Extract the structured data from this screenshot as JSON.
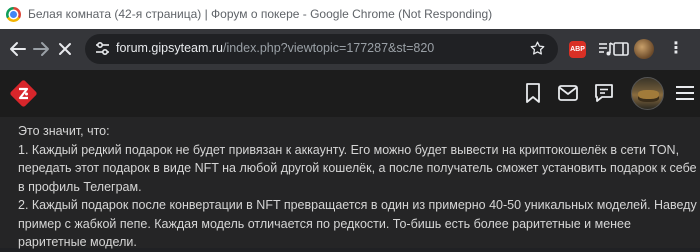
{
  "window": {
    "title": "Белая комната (42-я страница) | Форум о покере - Google Chrome (Not Responding)"
  },
  "toolbar": {
    "back_icon": "back-arrow-icon",
    "forward_icon": "forward-arrow-icon",
    "stop_icon": "stop-loading-icon",
    "url_host": "forum.gipsyteam.ru",
    "url_path": "/index.php?viewtopic=177287&st=820",
    "abp_label": "ABP",
    "extensions": [
      "adblock-plus-icon",
      "media-controls-icon",
      "side-panel-icon",
      "profile-icon",
      "more-menu-icon"
    ]
  },
  "site": {
    "icons": [
      "site-logo-icon",
      "bookmark-icon",
      "mail-icon",
      "chat-icon",
      "avatar",
      "hamburger-menu-icon"
    ]
  },
  "post": {
    "lines": [
      "Это значит, что:",
      "1. Каждый редкий подарок не будет привязан к аккаунту. Его можно будет вывести на криптокошелёк в сети TON,",
      "передать этот подарок в виде NFT на любой другой кошелёк, а после получатель сможет установить подарок к себе",
      "в профиль Телеграм.",
      "2. Каждый подарок после конвертации в NFT превращается в один из примерно 40-50 уникальных моделей. Наведу",
      "пример с жабкой пепе. Каждая модель отличается по редкости. То-бишь есть более раритетные и менее",
      "раритетные модели."
    ]
  },
  "colors": {
    "toolbar_bg": "#35363a",
    "omnibox_bg": "#202124",
    "site_header_bg": "#1c1c1c",
    "content_bg": "#252526",
    "logo_red": "#d7262b",
    "abp_red": "#d93025"
  }
}
